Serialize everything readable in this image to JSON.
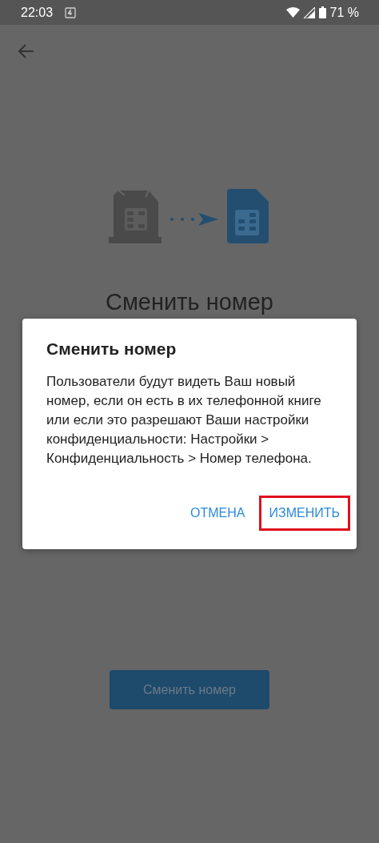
{
  "status_bar": {
    "time": "22:03",
    "battery": "71 %"
  },
  "page": {
    "title": "Сменить номер",
    "button": "Сменить номер"
  },
  "dialog": {
    "title": "Сменить номер",
    "message": "Пользователи будут видеть Ваш новый номер, если он есть в их телефонной книге или если это разрешают Ваши настройки конфиденциальности: Настройки > Конфиденциальность > Номер телефона.",
    "buttons": [
      {
        "label": "ОТМЕНА",
        "highlighted": false
      },
      {
        "label": "ИЗМЕНИТЬ",
        "highlighted": true
      }
    ]
  }
}
